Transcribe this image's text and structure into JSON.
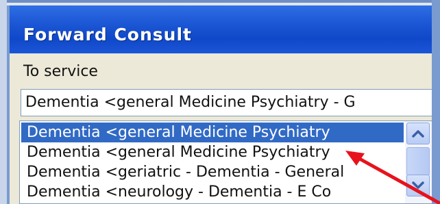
{
  "window": {
    "title": "Forward Consult"
  },
  "form": {
    "label": "To service",
    "combo_value": "Dementia  <general Medicine Psychiatry - G"
  },
  "list": {
    "items": [
      {
        "label": "Dementia  <general Medicine Psychiatry",
        "selected": true
      },
      {
        "label": "Dementia  <general Medicine Psychiatry",
        "selected": false
      },
      {
        "label": "Dementia  <geriatric - Dementia - General",
        "selected": false
      },
      {
        "label": "Dementia  <neurology - Dementia - E Co",
        "selected": false
      }
    ]
  },
  "scrollbar": {
    "up_icon": "chevron-up-icon",
    "down_icon": "chevron-down-icon"
  },
  "annotation": {
    "color": "#e8121c",
    "icon": "red-arrow-icon"
  },
  "colors": {
    "titlebar": "#1d58d6",
    "selection": "#316ac5"
  }
}
